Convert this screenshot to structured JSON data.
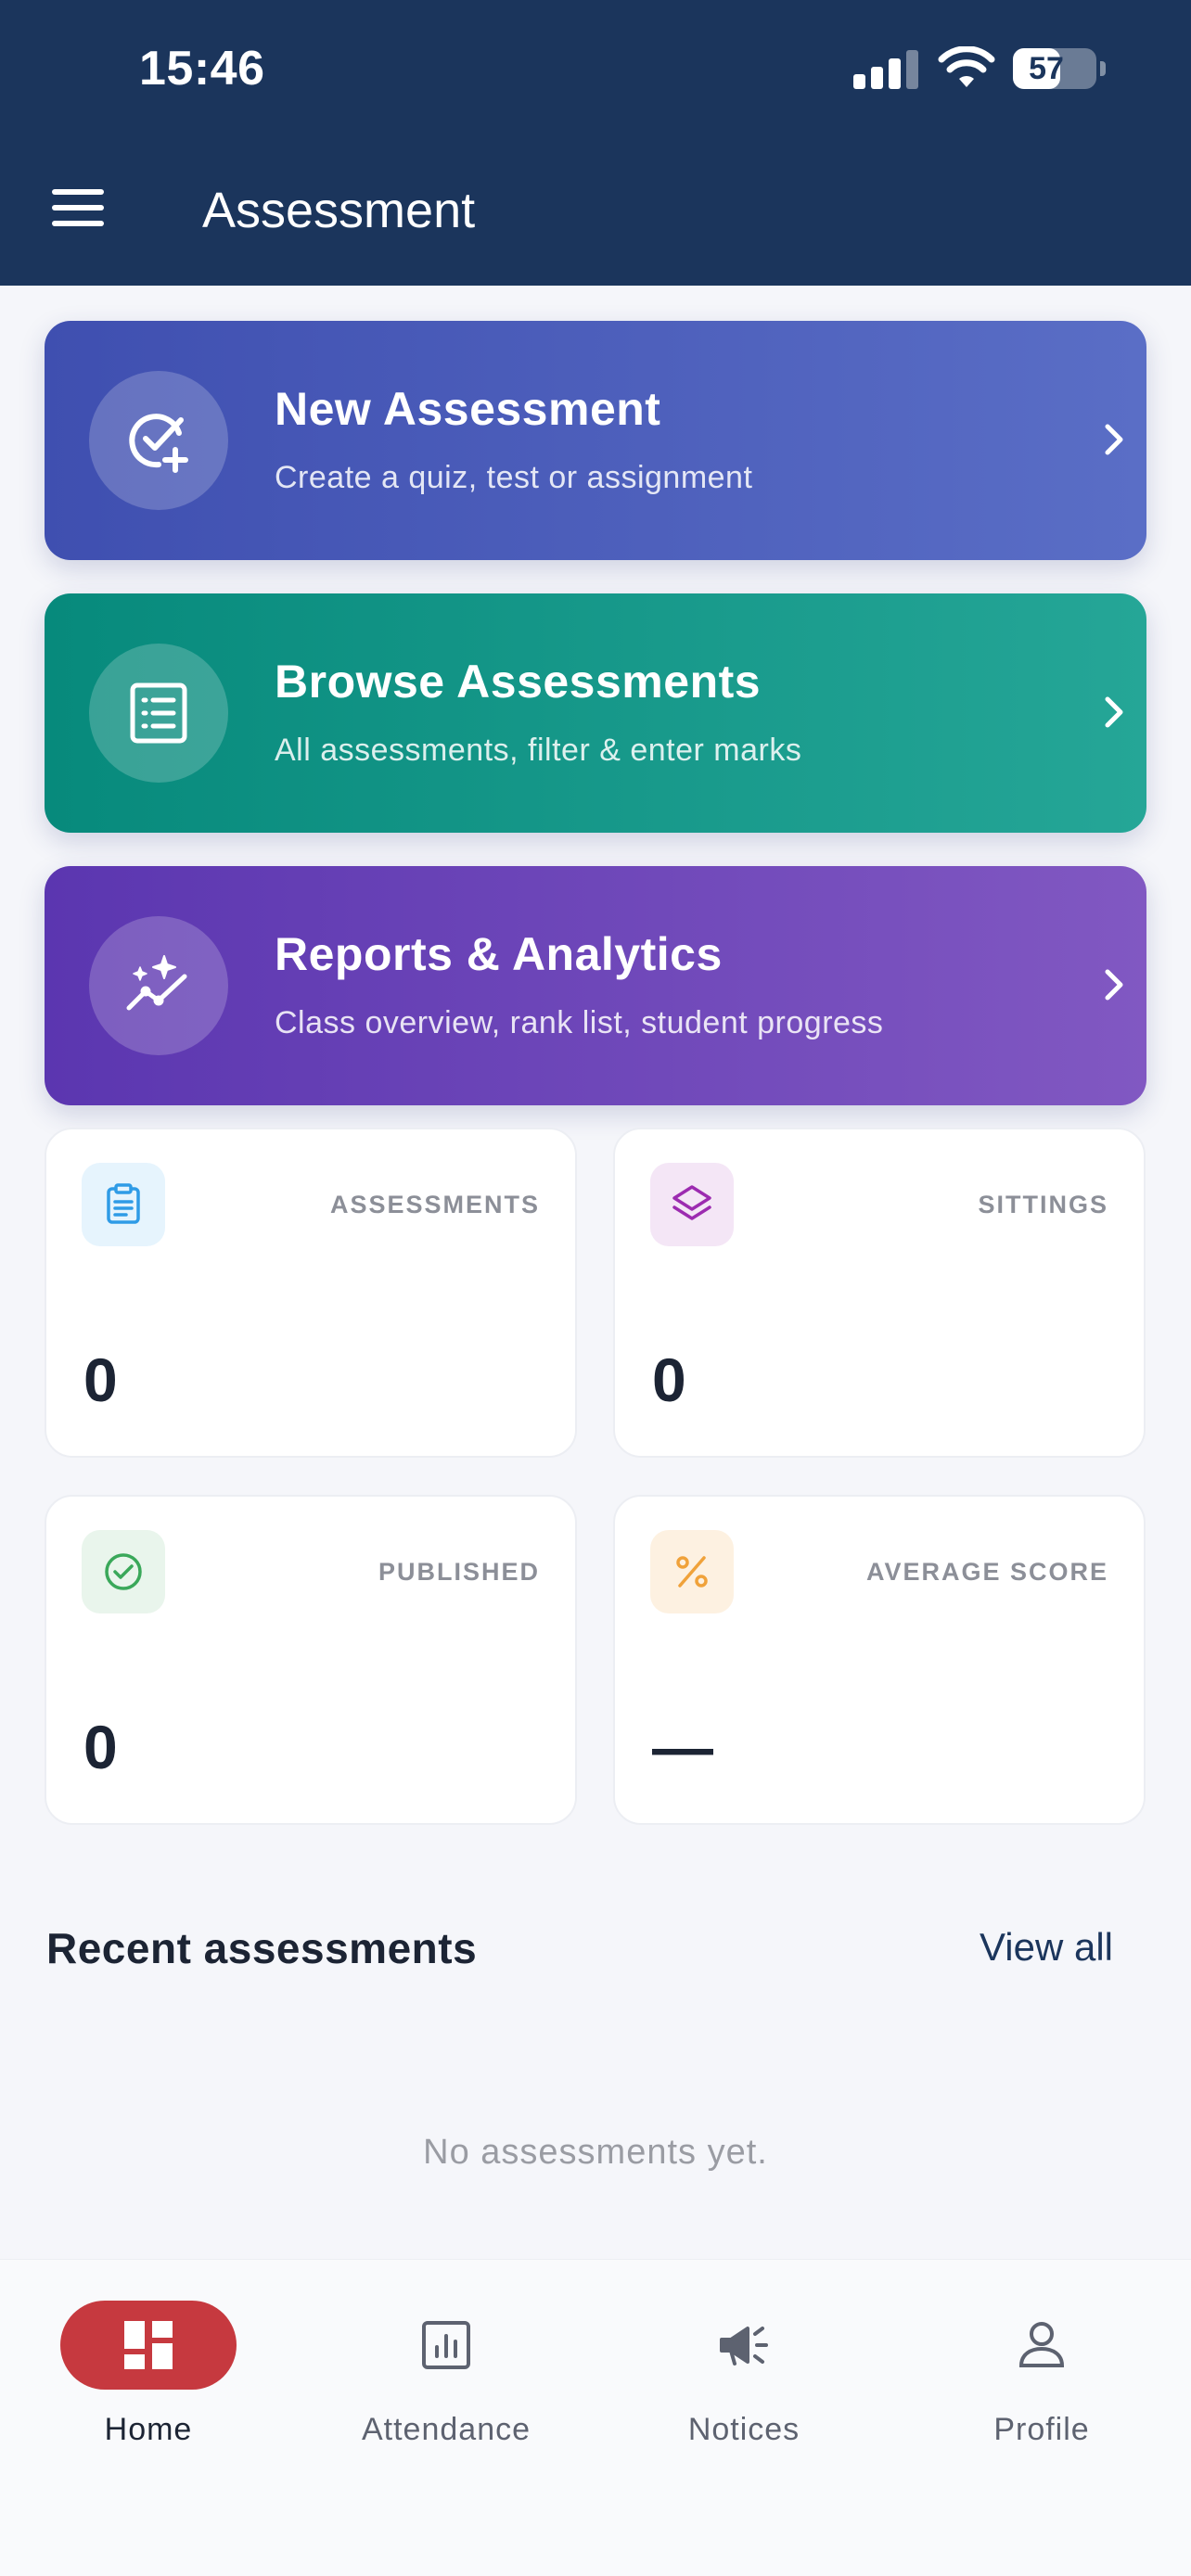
{
  "status_bar": {
    "time": "15:46",
    "battery": "57"
  },
  "header": {
    "title": "Assessment"
  },
  "actions": [
    {
      "title": "New Assessment",
      "subtitle": "Create a quiz, test or assignment",
      "icon": "check-circle-plus-icon"
    },
    {
      "title": "Browse Assessments",
      "subtitle": "All assessments, filter & enter marks",
      "icon": "list-document-icon"
    },
    {
      "title": "Reports & Analytics",
      "subtitle": "Class overview, rank list, student progress",
      "icon": "sparkle-chart-icon"
    }
  ],
  "stats": [
    {
      "label": "ASSESSMENTS",
      "value": "0",
      "icon": "clipboard-icon",
      "color": "#2f9be6",
      "bg": "#e6f4fd"
    },
    {
      "label": "SITTINGS",
      "value": "0",
      "icon": "layers-icon",
      "color": "#9c2bb0",
      "bg": "#f4e6f6"
    },
    {
      "label": "PUBLISHED",
      "value": "0",
      "icon": "check-circle-icon",
      "color": "#3aa85a",
      "bg": "#e9f5ec"
    },
    {
      "label": "AVERAGE SCORE",
      "value": "—",
      "icon": "percent-icon",
      "color": "#f0a23a",
      "bg": "#fdf1e1"
    }
  ],
  "recent": {
    "title": "Recent assessments",
    "view_all": "View all",
    "empty": "No assessments yet."
  },
  "nav": [
    {
      "label": "Home",
      "icon": "dashboard-icon",
      "active": true
    },
    {
      "label": "Attendance",
      "icon": "bar-chart-icon",
      "active": false
    },
    {
      "label": "Notices",
      "icon": "megaphone-icon",
      "active": false
    },
    {
      "label": "Profile",
      "icon": "person-icon",
      "active": false
    }
  ],
  "colors": {
    "header": "#1b355c",
    "accent_active": "#c6393f",
    "card_blue": "#4a5cbb",
    "card_teal": "#17998a",
    "card_purple": "#6c46b9"
  }
}
